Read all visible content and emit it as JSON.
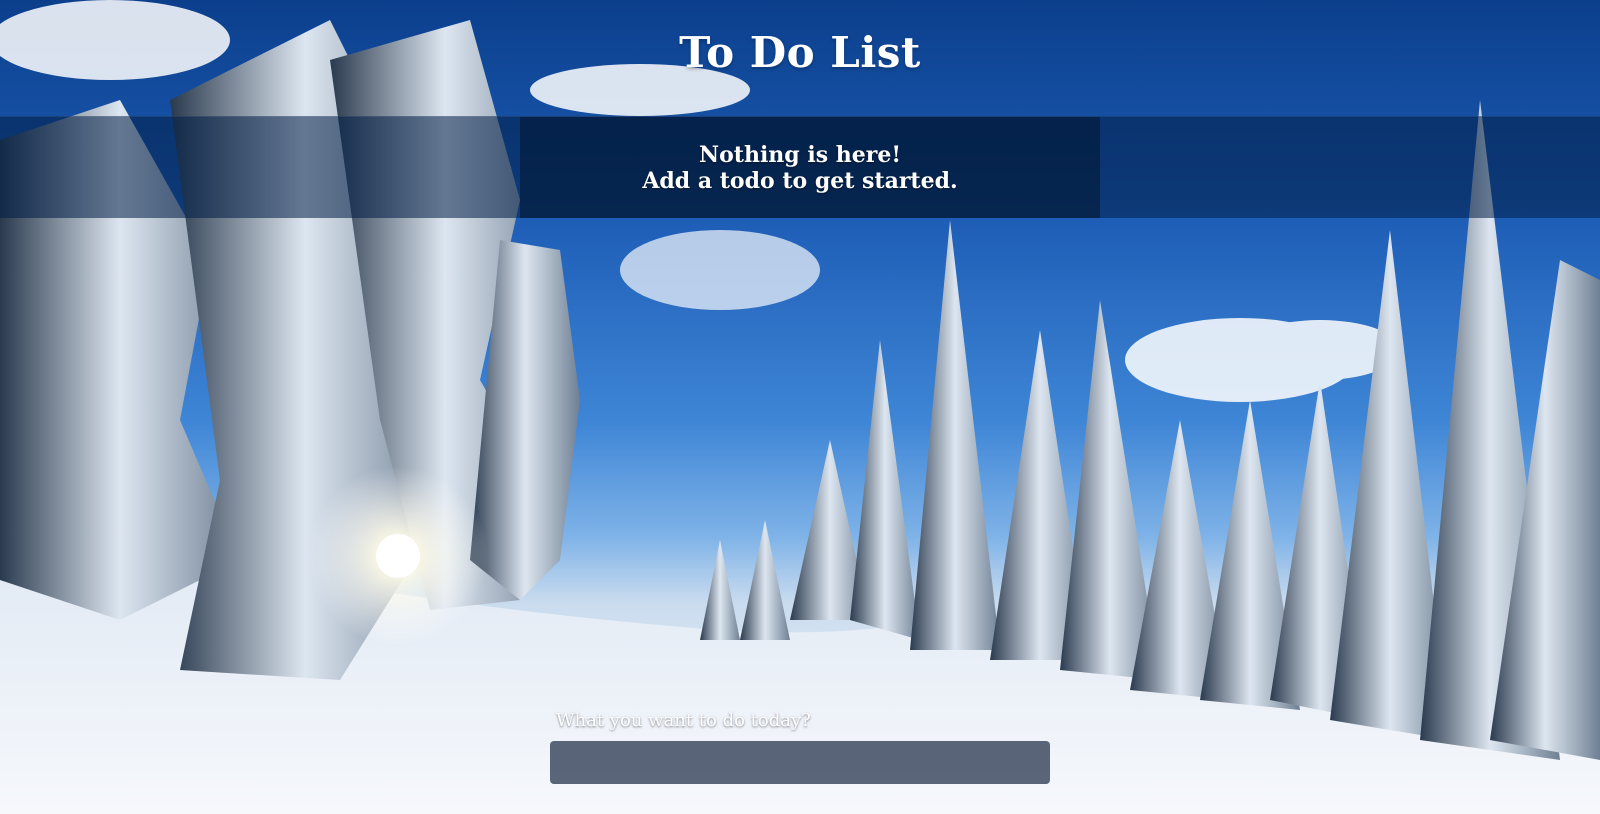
{
  "app": {
    "title": "To Do List"
  },
  "status": {
    "line1": "Nothing is here!",
    "line2": "Add a todo to get started."
  },
  "form": {
    "label": "What you want to do today?",
    "value": "",
    "placeholder": ""
  },
  "colors": {
    "text": "#ffffff",
    "band": "#0a2a55",
    "input_bg": "#1e2d46"
  }
}
